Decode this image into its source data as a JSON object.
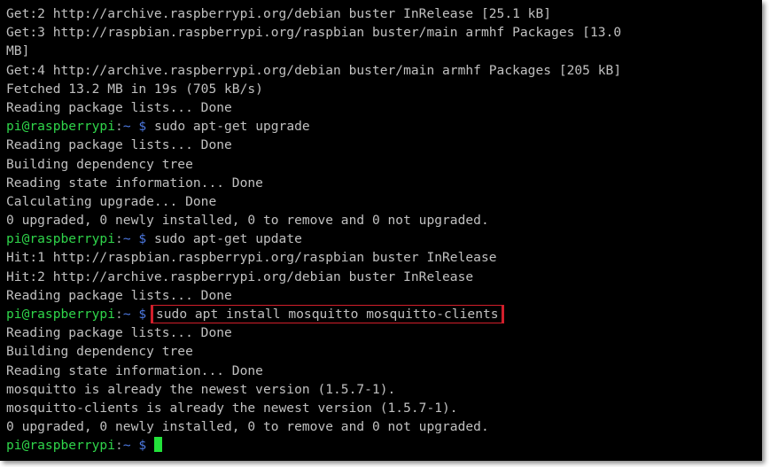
{
  "terminal": {
    "lines": [
      {
        "type": "output",
        "text": "Get:2 http://archive.raspberrypi.org/debian buster InRelease [25.1 kB]"
      },
      {
        "type": "output",
        "text": "Get:3 http://raspbian.raspberrypi.org/raspbian buster/main armhf Packages [13.0"
      },
      {
        "type": "output",
        "text": "MB]"
      },
      {
        "type": "output",
        "text": "Get:4 http://archive.raspberrypi.org/debian buster/main armhf Packages [205 kB]"
      },
      {
        "type": "output",
        "text": "Fetched 13.2 MB in 19s (705 kB/s)"
      },
      {
        "type": "output",
        "text": "Reading package lists... Done"
      },
      {
        "type": "prompt",
        "command": "sudo apt-get upgrade"
      },
      {
        "type": "output",
        "text": "Reading package lists... Done"
      },
      {
        "type": "output",
        "text": "Building dependency tree"
      },
      {
        "type": "output",
        "text": "Reading state information... Done"
      },
      {
        "type": "output",
        "text": "Calculating upgrade... Done"
      },
      {
        "type": "output",
        "text": "0 upgraded, 0 newly installed, 0 to remove and 0 not upgraded."
      },
      {
        "type": "prompt",
        "command": "sudo apt-get update"
      },
      {
        "type": "output",
        "text": "Hit:1 http://raspbian.raspberrypi.org/raspbian buster InRelease"
      },
      {
        "type": "output",
        "text": "Hit:2 http://archive.raspberrypi.org/debian buster InRelease"
      },
      {
        "type": "output",
        "text": "Reading package lists... Done"
      },
      {
        "type": "prompt",
        "command": "sudo apt install mosquitto mosquitto-clients",
        "highlighted": true
      },
      {
        "type": "output",
        "text": "Reading package lists... Done"
      },
      {
        "type": "output",
        "text": "Building dependency tree"
      },
      {
        "type": "output",
        "text": "Reading state information... Done"
      },
      {
        "type": "output",
        "text": "mosquitto is already the newest version (1.5.7-1)."
      },
      {
        "type": "output",
        "text": "mosquitto-clients is already the newest version (1.5.7-1)."
      },
      {
        "type": "output",
        "text": "0 upgraded, 0 newly installed, 0 to remove and 0 not upgraded."
      },
      {
        "type": "prompt",
        "command": "",
        "cursor": true
      }
    ],
    "prompt": {
      "user_host": "pi@raspberrypi",
      "separator": ":",
      "path": "~",
      "dollar": " $ "
    },
    "colors": {
      "background": "#000000",
      "text": "#c0c0c0",
      "prompt_user": "#2fd44a",
      "prompt_path": "#4c78e0",
      "highlight_box": "#d11f2b",
      "cursor": "#22e23a"
    }
  }
}
